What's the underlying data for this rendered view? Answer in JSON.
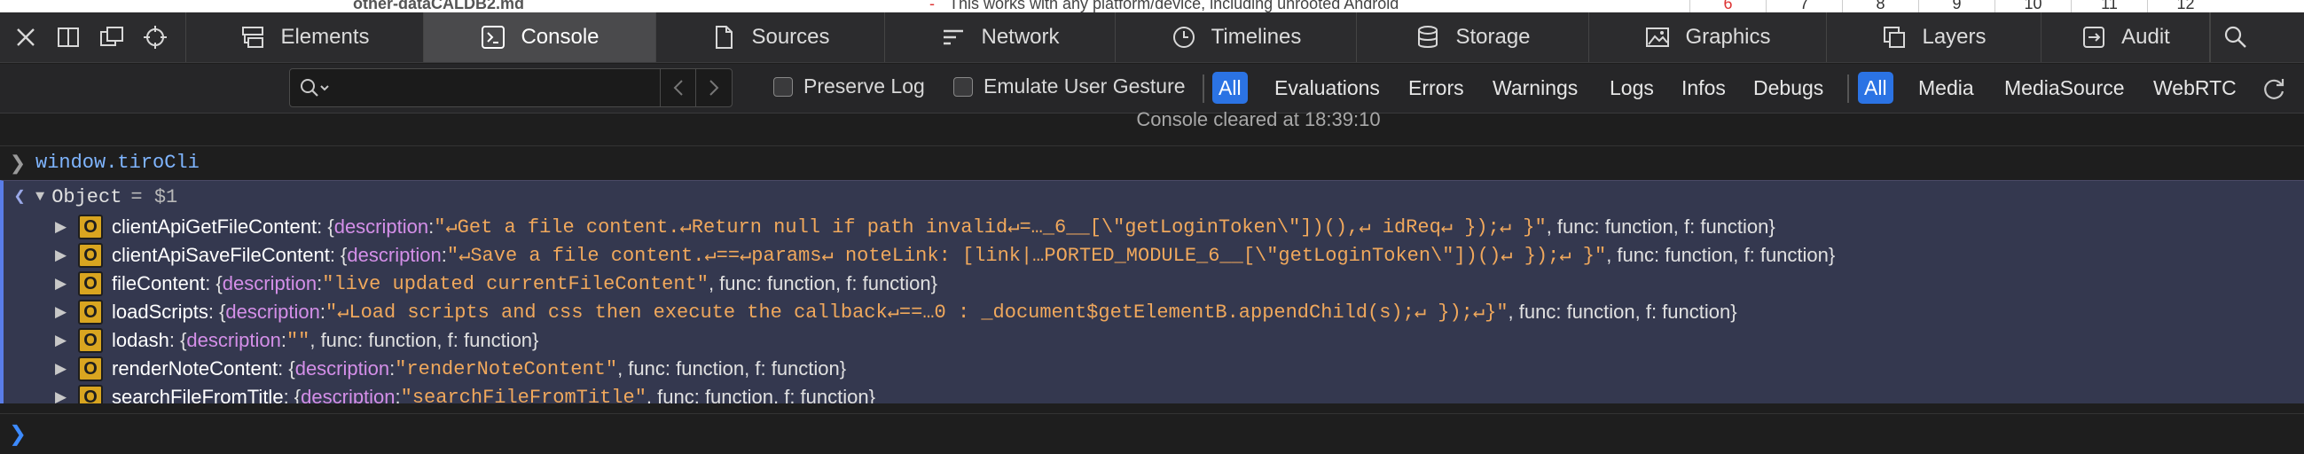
{
  "background_page": {
    "left_text": "other-dataCALDB2.md",
    "diff_marker": "-",
    "diff_text": "This works with any platform/device, including unrooted Android",
    "numbers": [
      "6",
      "7",
      "8",
      "9",
      "10",
      "11",
      "12"
    ]
  },
  "toolbar": {
    "dock_icons": [
      "close-icon",
      "dock-side-icon",
      "detach-window-icon",
      "element-picker-icon"
    ],
    "tabs": [
      {
        "label": "Elements",
        "icon": "elements-icon",
        "active": false
      },
      {
        "label": "Console",
        "icon": "console-icon",
        "active": true
      },
      {
        "label": "Sources",
        "icon": "sources-icon",
        "active": false
      },
      {
        "label": "Network",
        "icon": "network-icon",
        "active": false
      },
      {
        "label": "Timelines",
        "icon": "timelines-icon",
        "active": false
      },
      {
        "label": "Storage",
        "icon": "storage-icon",
        "active": false
      },
      {
        "label": "Graphics",
        "icon": "graphics-icon",
        "active": false
      },
      {
        "label": "Layers",
        "icon": "layers-icon",
        "active": false
      },
      {
        "label": "Audit",
        "icon": "audit-icon",
        "active": false
      }
    ]
  },
  "filter_bar": {
    "search_placeholder": "",
    "preserve_log": "Preserve Log",
    "emulate_gesture": "Emulate User Gesture",
    "level_filters": [
      "All",
      "Evaluations",
      "Errors",
      "Warnings",
      "Logs",
      "Infos",
      "Debugs"
    ],
    "source_filters": [
      "All",
      "Media",
      "MediaSource",
      "WebRTC"
    ],
    "accent_color": "#2b73e4"
  },
  "console": {
    "cleared_message": "Console cleared at 18:39:10",
    "input_command": "window.tiroCli",
    "result": {
      "type": "Object",
      "var_label": "= $1",
      "properties": [
        {
          "name": "clientApiGetFileContent",
          "desc": "\"↵Get a file content.↵Return null if path invalid↵=…_6__[\\\"getLoginToken\\\"])(),↵      idReq↵    });↵  }\"",
          "rest": ", func: function, f: function}"
        },
        {
          "name": "clientApiSaveFileContent",
          "desc": "\"↵Save a file content.↵==↵params↵  noteLink: [link|…PORTED_MODULE_6__[\\\"getLoginToken\\\"])()↵    });↵  }\"",
          "rest": ", func: function, f: function}"
        },
        {
          "name": "fileContent",
          "desc": "\"live updated currentFileContent\"",
          "rest": ", func: function, f: function}"
        },
        {
          "name": "loadScripts",
          "desc": "\"↵Load scripts and css then execute the callback↵==…0 : _document$getElementB.appendChild(s);↵  });↵}\"",
          "rest": ", func: function, f: function}"
        },
        {
          "name": "lodash",
          "desc": "\"\"",
          "rest": ", func: function, f: function}"
        },
        {
          "name": "renderNoteContent",
          "desc": "\"renderNoteContent\"",
          "rest": ", func: function, f: function}"
        },
        {
          "name": "searchFileFromTitle",
          "desc": "\"searchFileFromTitle\"",
          "rest": ", func: function, f: function}"
        }
      ],
      "badge_letter": "O",
      "key_label": "description",
      "punct_open": ": {",
      "punct_colon": ": "
    }
  }
}
